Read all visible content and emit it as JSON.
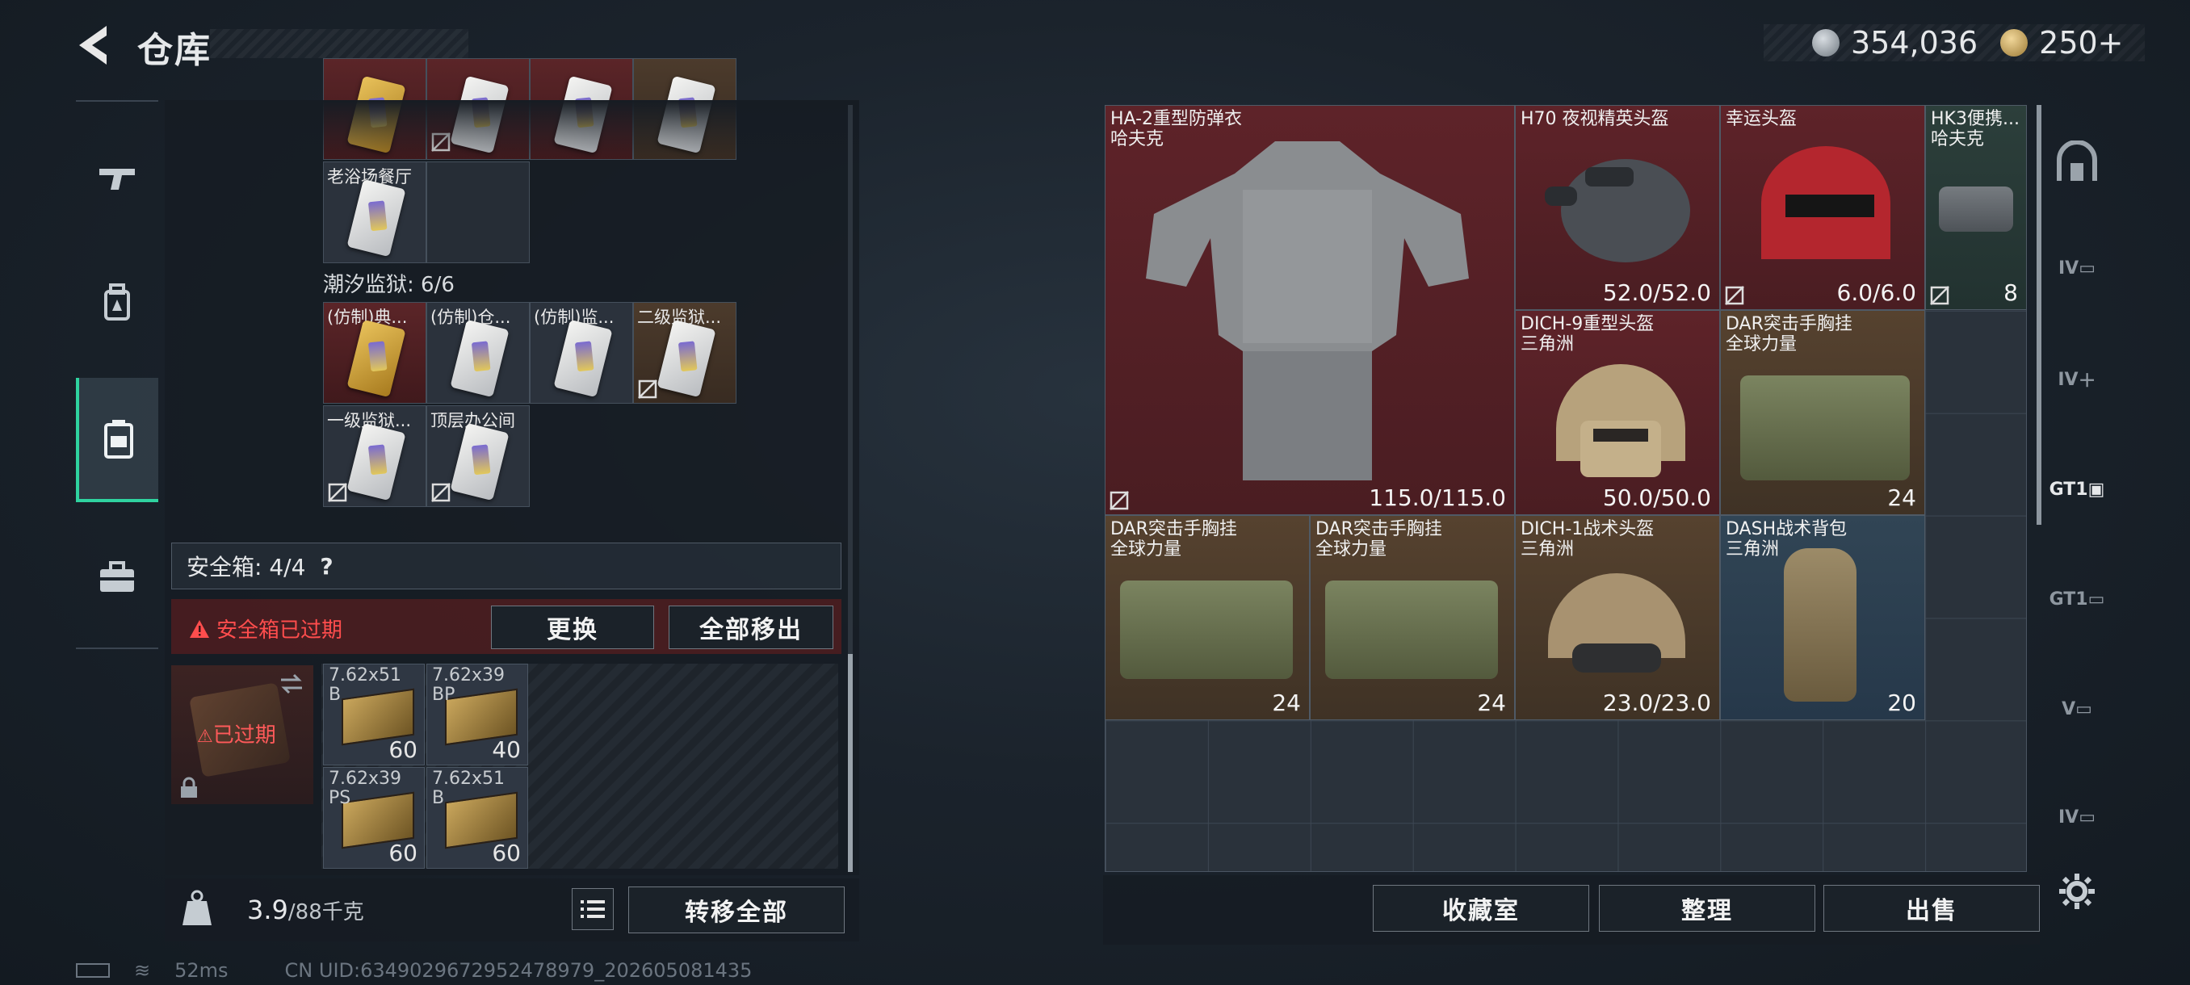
{
  "header": {
    "title": "仓库",
    "currency_silver": "354,036",
    "currency_gold": "250+"
  },
  "left": {
    "top_slots": [
      {
        "label": "",
        "tone": "red",
        "card": "gold",
        "nodrop": false
      },
      {
        "label": "",
        "tone": "red",
        "card": "white",
        "nodrop": true
      },
      {
        "label": "",
        "tone": "red",
        "card": "white",
        "nodrop": false
      },
      {
        "label": "",
        "tone": "brown",
        "card": "white",
        "nodrop": false
      }
    ],
    "row2_label": "老浴场餐厅",
    "section_title": "潮汐监狱: 6/6",
    "prison_slots": [
      {
        "label": "(仿制)典...",
        "tone": "red",
        "card": "gold",
        "nodrop": false
      },
      {
        "label": "(仿制)仓...",
        "tone": "grey",
        "card": "white",
        "nodrop": false
      },
      {
        "label": "(仿制)监...",
        "tone": "grey",
        "card": "white",
        "nodrop": false
      },
      {
        "label": "二级监狱...",
        "tone": "brown",
        "card": "white",
        "nodrop": true
      },
      {
        "label": "一级监狱...",
        "tone": "grey",
        "card": "white",
        "nodrop": true
      },
      {
        "label": "顶层办公间",
        "tone": "grey",
        "card": "white",
        "nodrop": true
      }
    ],
    "safebox_label": "安全箱: 4/4",
    "safebox_help": "?",
    "warning": "安全箱已过期",
    "replace_button": "更换",
    "move_all_out_button": "全部移出",
    "expired_label": "已过期",
    "ammo": [
      {
        "line1": "7.62x51",
        "line2": "B",
        "qty": "60"
      },
      {
        "line1": "7.62x39",
        "line2": "BP",
        "qty": "40"
      },
      {
        "line1": "7.62x39",
        "line2": "PS",
        "qty": "60"
      },
      {
        "line1": "7.62x51",
        "line2": "B",
        "qty": "60"
      }
    ],
    "weight_value": "3.9",
    "weight_max": "/88千克",
    "transfer_all_button": "转移全部"
  },
  "grid_items": [
    {
      "name1": "HA-2重型防弹衣",
      "name2": "哈夫克",
      "value": "115.0/115.0"
    },
    {
      "name1": "H70 夜视精英头盔",
      "name2": "",
      "value": "52.0/52.0"
    },
    {
      "name1": "幸运头盔",
      "name2": "",
      "value": "6.0/6.0"
    },
    {
      "name1": "HK3便携...",
      "name2": "哈夫克",
      "value": "8"
    },
    {
      "name1": "DICH-9重型头盔",
      "name2": "三角洲",
      "value": "50.0/50.0"
    },
    {
      "name1": "DAR突击手胸挂",
      "name2": "全球力量",
      "value": "24"
    },
    {
      "name1": "DAR突击手胸挂",
      "name2": "全球力量",
      "value": "24"
    },
    {
      "name1": "DAR突击手胸挂",
      "name2": "全球力量",
      "value": "24"
    },
    {
      "name1": "DICH-1战术头盔",
      "name2": "三角洲",
      "value": "23.0/23.0"
    },
    {
      "name1": "DASH战术背包",
      "name2": "三角洲",
      "value": "20"
    }
  ],
  "bottom_buttons": {
    "collection": "收藏室",
    "sort": "整理",
    "sell": "出售"
  },
  "right_rail": [
    "IV",
    "IV",
    "GT1",
    "GT1",
    "V",
    "IV"
  ],
  "status": {
    "ping": "52ms",
    "uid": "CN UID:6349029672952478979_202605081435"
  },
  "colors": {
    "accent": "#2fd3a0",
    "warning": "#ff4d4d"
  }
}
